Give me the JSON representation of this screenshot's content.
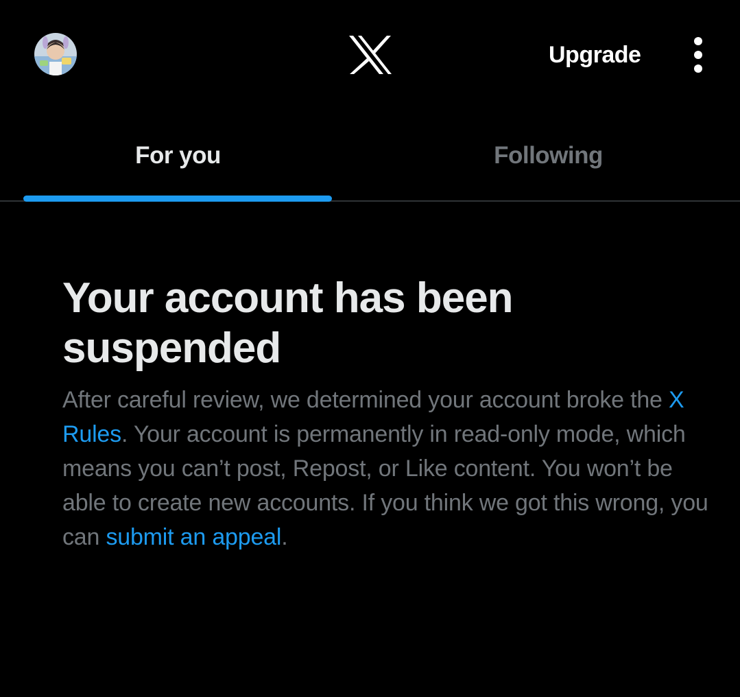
{
  "header": {
    "avatar_icon": "user-avatar-icon",
    "logo_icon": "x-logo-icon",
    "upgrade_label": "Upgrade",
    "more_icon": "more-vertical-icon"
  },
  "tabs": [
    {
      "label": "For you",
      "active": true
    },
    {
      "label": "Following",
      "active": false
    }
  ],
  "notice": {
    "title": "Your account has been suspended",
    "body_part1": "After careful review, we determined your account broke the ",
    "rules_link": "X Rules",
    "body_part2": ". Your account is permanently in read-only mode, which means you can’t post, Repost, or Like content. You won’t be able to create new accounts. If you think we got this wrong, you can ",
    "appeal_link": "submit an appeal",
    "body_part3": "."
  },
  "colors": {
    "background": "#000000",
    "text_primary": "#e7e9ea",
    "text_secondary": "#71767b",
    "accent": "#1d9bf0",
    "divider": "#2f3336"
  }
}
